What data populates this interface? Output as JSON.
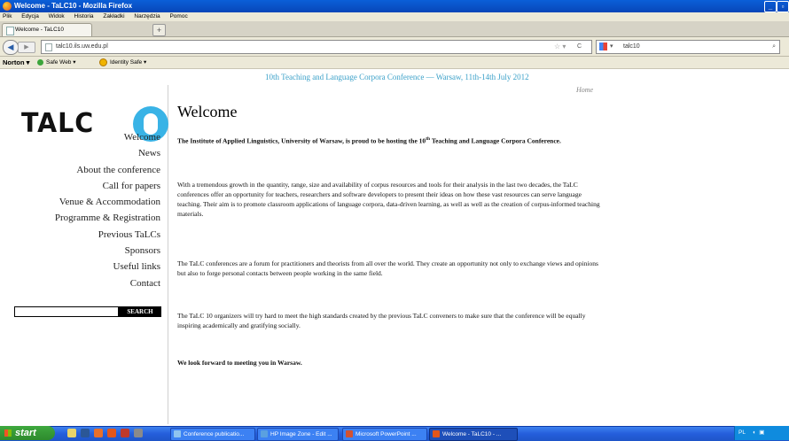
{
  "window": {
    "title": "Welcome - TaLC10 - Mozilla Firefox"
  },
  "menubar": [
    "Plik",
    "Edycja",
    "Widok",
    "Historia",
    "Zakładki",
    "Narzędzia",
    "Pomoc"
  ],
  "tabs": [
    {
      "label": "Welcome - TaLC10"
    }
  ],
  "newtab_label": "+",
  "navbar": {
    "url": "talc10.ils.uw.edu.pl",
    "search_value": "talc10"
  },
  "norton": {
    "logo": "Norton",
    "safe_web": "Safe Web",
    "identity_safe": "Identity Safe"
  },
  "page": {
    "banner": "10th Teaching and Language Corpora Conference — Warsaw, 11th-14th July 2012",
    "breadcrumb": "Home",
    "logo_text": "TALC",
    "nav": [
      "Welcome",
      "News",
      "About the conference",
      "Call for papers",
      "Venue & Accommodation",
      "Programme & Registration",
      "Previous TaLCs",
      "Sponsors",
      "Useful links",
      "Contact"
    ],
    "search": {
      "value": "",
      "button": "SEARCH"
    },
    "title": "Welcome",
    "intro_a": "The Institute of Applied Linguistics, University of Warsaw, is proud to be hosting the 10",
    "intro_sup": "th",
    "intro_b": " Teaching and Language Corpora Conference.",
    "paragraphs": {
      "growth": "With a tremendous growth in the quantity, range, size and availability of corpus resources and tools for their analysis in the last two decades, the TaLC conferences offer an opportunity for teachers, researchers and software developers to present their ideas on how these vast resources can serve language teaching. Their aim is to promote classroom applications of language corpora, data-driven learning, as well as well as the creation of corpus-informed teaching materials.",
      "forum": "The TaLC conferences are a forum for practitioners and theorists from all over the world. They create an opportunity not only to exchange views and opinions but also to forge personal contacts between people working in the same field.",
      "organizers": "The TaLC 10 organizers will try hard to meet the high standards created by the previous TaLC conveners to make sure that the conference will be equally inspiring academically and gratifying socially.",
      "look_forward": "We look forward to meeting you in Warsaw."
    }
  },
  "taskbar": {
    "start": "start",
    "tasks": [
      "Conference publicatio...",
      "HP Image Zone - Edit ...",
      "Microsoft PowerPoint ...",
      "Welcome - TaLC10 - ..."
    ],
    "tray_lang": "PL"
  },
  "colors": {
    "accent": "#39b3e6",
    "banner": "#3aa0c8",
    "taskbar": "#245edb",
    "start": "#3fa93f"
  }
}
